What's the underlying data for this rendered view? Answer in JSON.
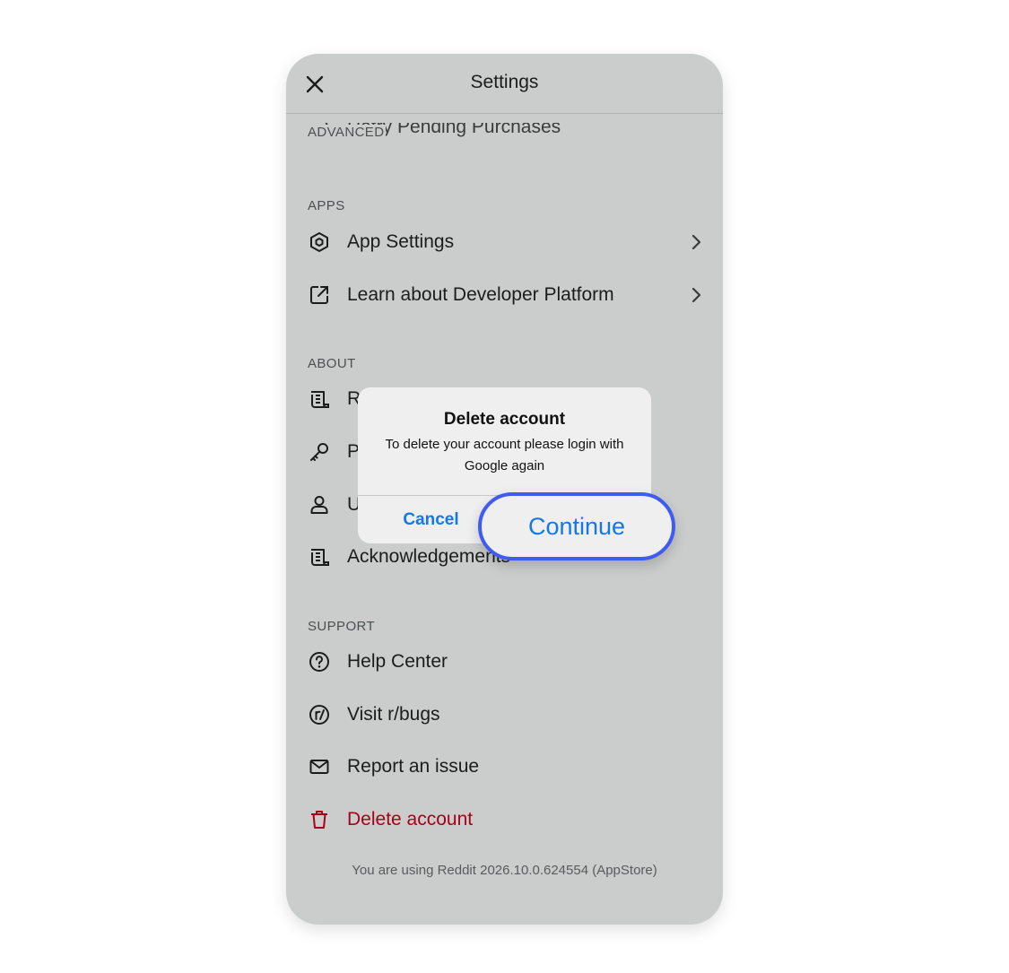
{
  "header": {
    "title": "Settings",
    "close_icon": "close-icon"
  },
  "peek": {
    "text": "Retry Pending Purchases"
  },
  "sections": {
    "advanced": "ADVANCED",
    "apps": "APPS",
    "about": "ABOUT",
    "support": "SUPPORT"
  },
  "apps": [
    {
      "label": "App Settings",
      "icon": "hexagon-icon"
    },
    {
      "label": "Learn about Developer Platform",
      "icon": "external-link-icon"
    }
  ],
  "about": [
    {
      "label": "R",
      "icon": "scroll-icon"
    },
    {
      "label": "P",
      "icon": "key-icon"
    },
    {
      "label": "U",
      "icon": "person-icon"
    },
    {
      "label": "Acknowledgements",
      "icon": "scroll-icon"
    }
  ],
  "support": [
    {
      "label": "Help Center",
      "icon": "help-icon"
    },
    {
      "label": "Visit r/bugs",
      "icon": "reddit-r-icon"
    },
    {
      "label": "Report an issue",
      "icon": "mail-icon"
    },
    {
      "label": "Delete account",
      "icon": "trash-icon"
    }
  ],
  "version_text": "You are using Reddit 2026.10.0.624554 (AppStore)",
  "dialog": {
    "title": "Delete account",
    "message": "To delete your account please login with Google again",
    "cancel_label": "Cancel",
    "continue_label": "Continue"
  },
  "colors": {
    "background": "#cbcdcd",
    "danger": "#a80017",
    "accent": "#1677e6",
    "highlight_ring": "#3f5bf0"
  }
}
